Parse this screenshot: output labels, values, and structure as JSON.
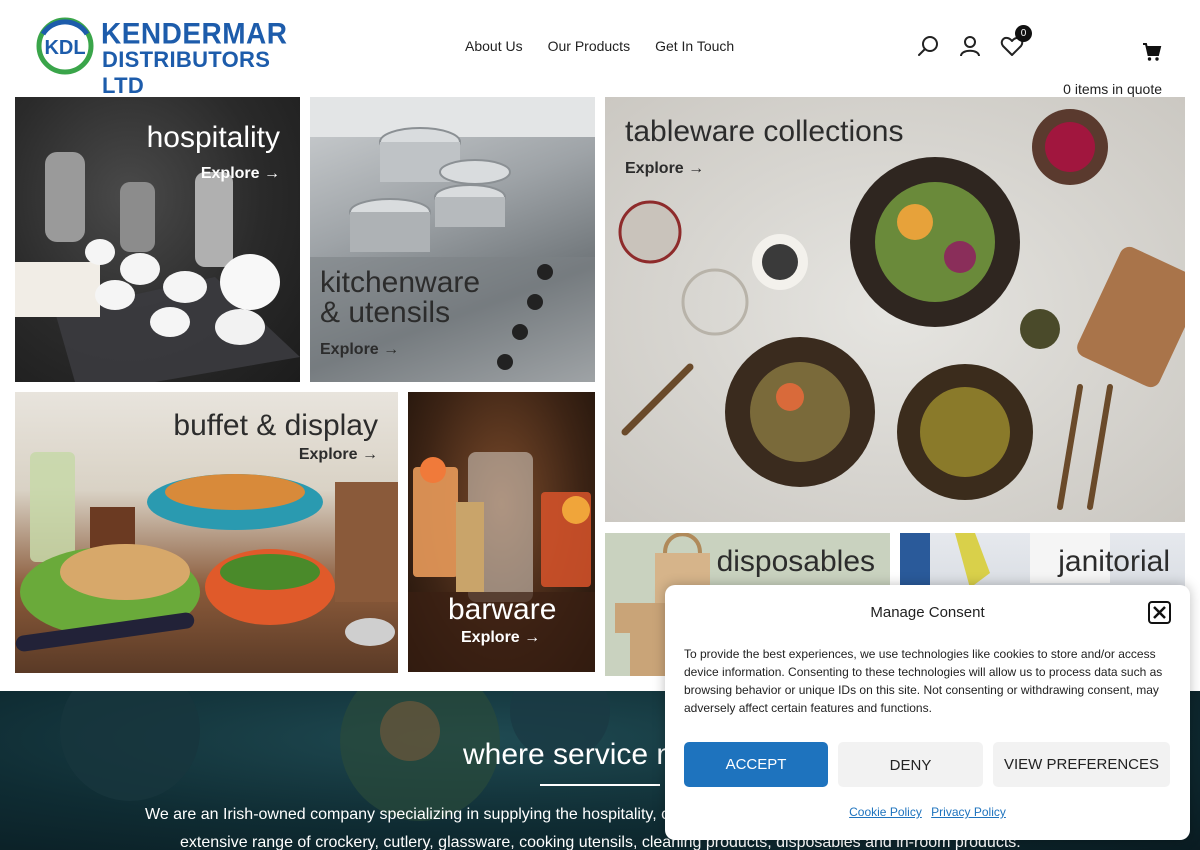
{
  "header": {
    "logo_line1": "KENDERMAR",
    "logo_line2": "DISTRIBUTORS LTD",
    "logo_mark": "KDL",
    "brand_blue": "#1d5cab",
    "brand_green": "#3aa54a"
  },
  "nav": {
    "items": [
      {
        "label": "About Us"
      },
      {
        "label": "Our Products"
      },
      {
        "label": "Get In Touch"
      }
    ]
  },
  "icons": {
    "search": "search-icon",
    "account": "user-icon",
    "wishlist": "heart-icon",
    "wishlist_count": "0",
    "cart": "cart-icon"
  },
  "quote_status": "0 items in quote",
  "tiles": {
    "hospitality": {
      "label": "hospitality",
      "explore": "Explore →"
    },
    "kitchenware_line1": "kitchenware",
    "kitchenware_line2": "& utensils",
    "kitchenware_explore": "Explore →",
    "tableware": {
      "label": "tableware collections",
      "explore": "Explore →"
    },
    "buffet": {
      "label": "buffet & display",
      "explore": "Explore →"
    },
    "barware": {
      "label": "barware",
      "explore": "Explore →"
    },
    "disposables": {
      "label": "disposables"
    },
    "janitorial": {
      "label": "janitorial"
    }
  },
  "banner": {
    "title": "where service m",
    "para1": "We are an Irish-owned company specializing in supplying the hospitality, c",
    "para2": "extensive range of crockery, cutlery, glassware, cooking utensils, cleaning products, disposables and in-room products."
  },
  "consent": {
    "title": "Manage Consent",
    "text": "To provide the best experiences, we use technologies like cookies to store and/or access device information. Consenting to these technologies will allow us to process data such as browsing behavior or unique IDs on this site. Not consenting or withdrawing consent, may adversely affect certain features and functions.",
    "accept": "ACCEPT",
    "deny": "DENY",
    "preferences": "VIEW PREFERENCES",
    "cookie_policy": "Cookie Policy",
    "privacy_policy": "Privacy Policy",
    "accent": "#1e73be"
  }
}
